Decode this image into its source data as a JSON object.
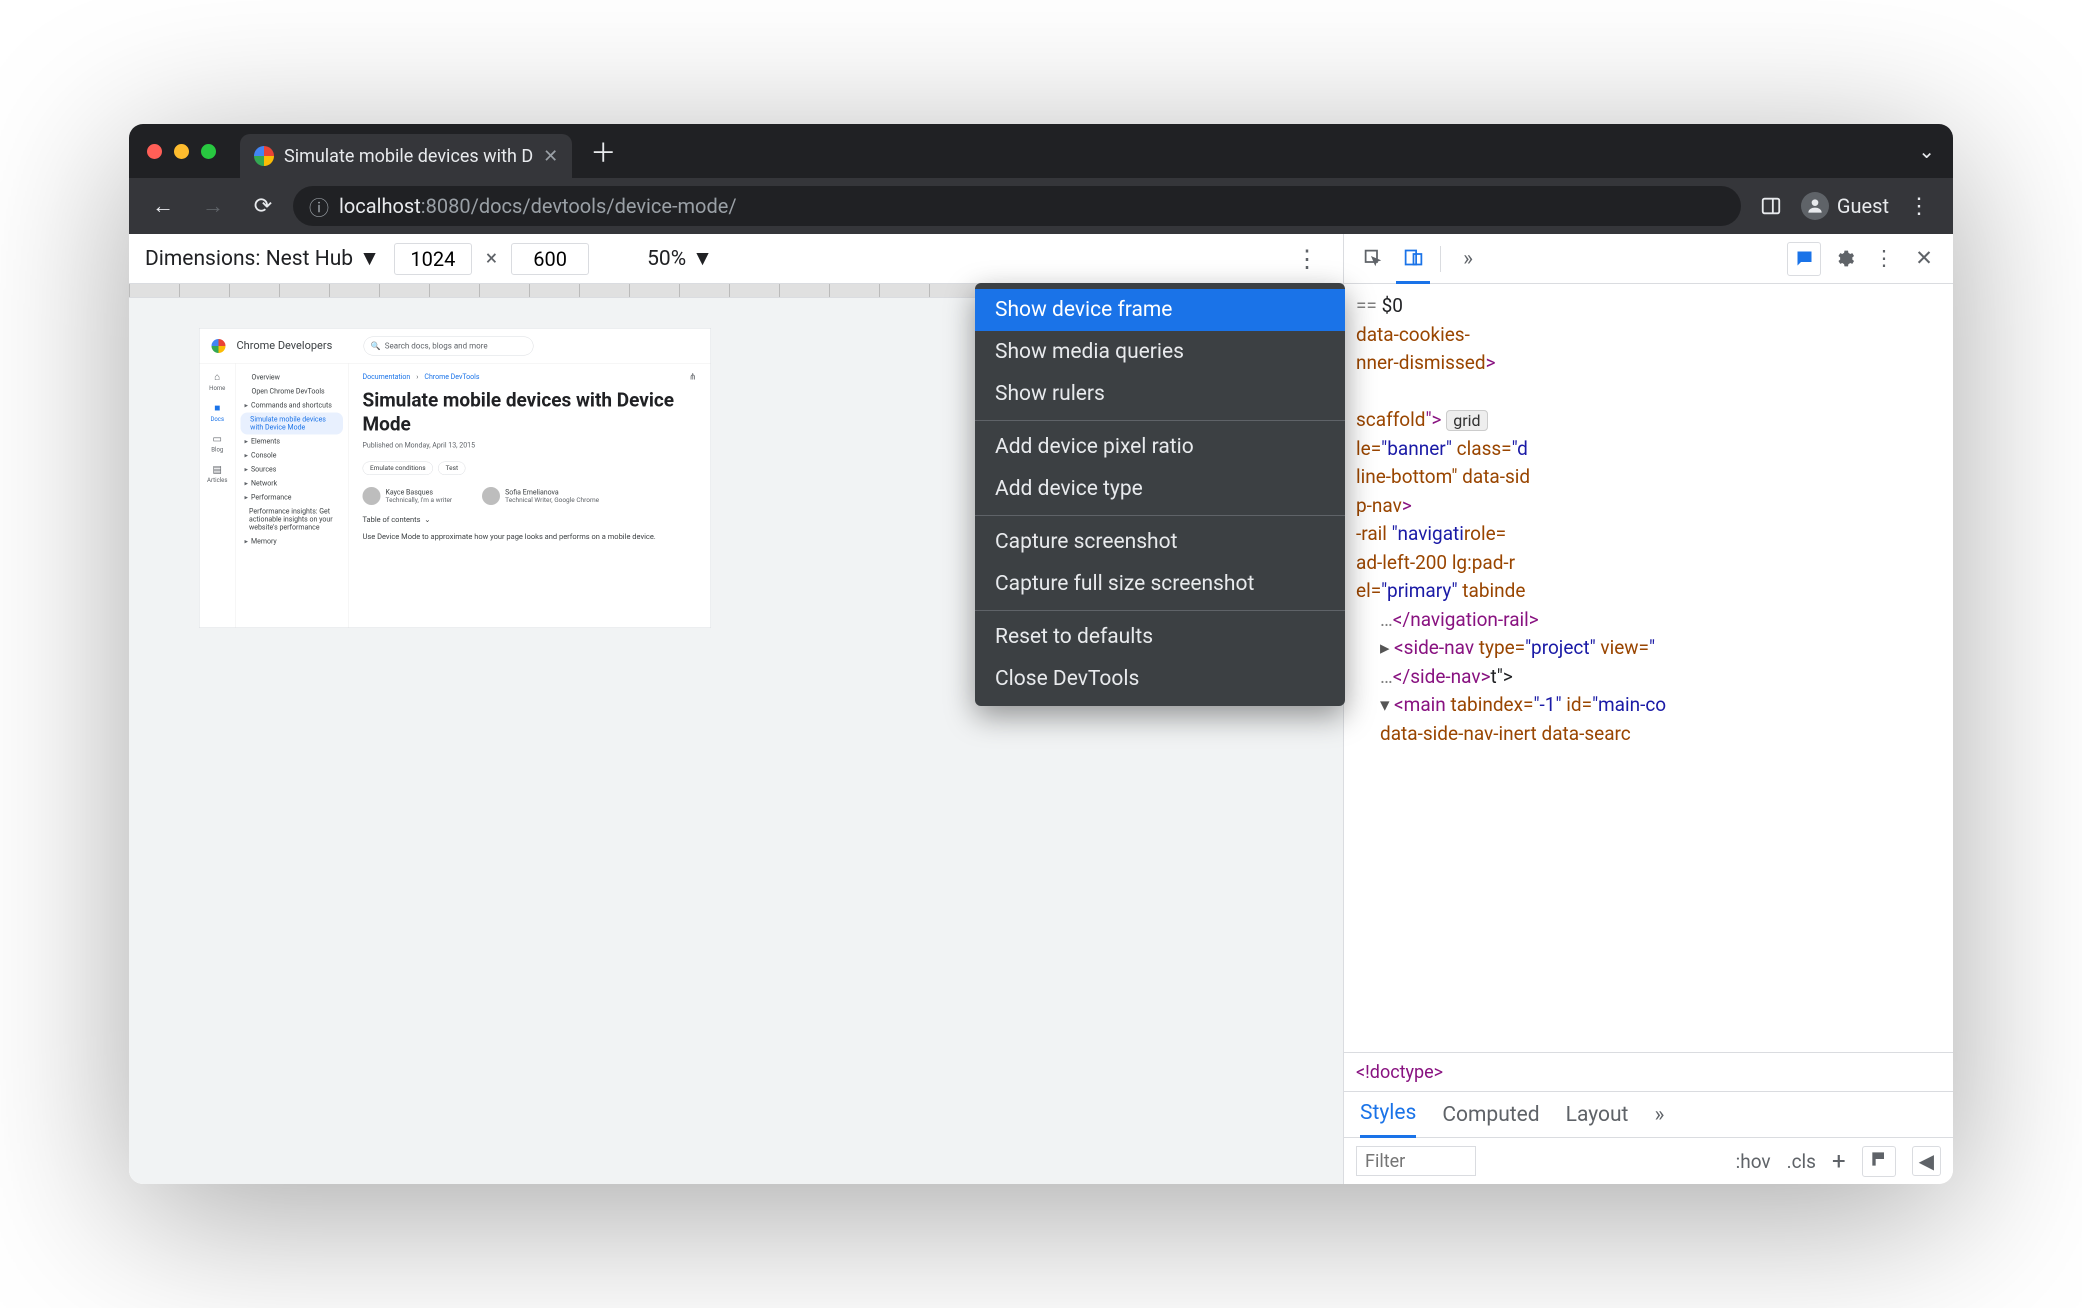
{
  "titlebar": {
    "tab_title": "Simulate mobile devices with D"
  },
  "toolbar": {
    "url_prefix": "localhost",
    "url_rest": ":8080/docs/devtools/device-mode/",
    "guest_label": "Guest"
  },
  "dim_bar": {
    "label": "Dimensions: Nest Hub",
    "width": "1024",
    "height": "600",
    "zoom": "50%"
  },
  "menu": {
    "items": [
      "Show device frame",
      "Show media queries",
      "Show rulers",
      "Add device pixel ratio",
      "Add device type",
      "Capture screenshot",
      "Capture full size screenshot",
      "Reset to defaults",
      "Close DevTools"
    ]
  },
  "mini": {
    "brand": "Chrome Developers",
    "search_placeholder": "Search docs, blogs and more",
    "nav": [
      "Home",
      "Docs",
      "Blog",
      "Articles"
    ],
    "side": [
      "Overview",
      "Open Chrome DevTools",
      "Commands and shortcuts",
      "Simulate mobile devices with Device Mode",
      "Elements",
      "Console",
      "Sources",
      "Network",
      "Performance",
      "Performance insights: Get actionable insights on your website's performance",
      "Memory"
    ],
    "breadcrumb": [
      "Documentation",
      "Chrome DevTools"
    ],
    "h1": "Simulate mobile devices with Device Mode",
    "published": "Published on Monday, April 13, 2015",
    "chips": [
      "Emulate conditions",
      "Test"
    ],
    "authors": [
      {
        "name": "Kayce Basques",
        "role": "Technically, I'm a writer"
      },
      {
        "name": "Sofia Emelianova",
        "role": "Technical Writer, Google Chrome"
      }
    ],
    "toc": "Table of contents",
    "para": "Use Device Mode to approximate how your page looks and performs on a mobile device."
  },
  "devtools": {
    "dom_lines": [
      {
        "indent": 0,
        "gray": "== ",
        "plain": "$0"
      },
      {
        "indent": 0,
        "attr": "data-cookies-"
      },
      {
        "indent": 0,
        "attr": "nner-dismissed",
        "tagclose": ">"
      },
      {
        "indent": 0,
        "blank": true
      },
      {
        "indent": 0,
        "attr": "scaffold",
        "tagclose": "\">",
        "badge": "grid"
      },
      {
        "indent": 0,
        "attr": "le=",
        "val": "\"banner\"",
        "attr2": " class=",
        "val2": "\"d"
      },
      {
        "indent": 0,
        "attr": "line-bottom\"",
        "attr2": " data-sid"
      },
      {
        "indent": 0,
        "attr": "p-nav",
        "tagclose": ">"
      },
      {
        "indent": 0,
        "attr": "-rail ",
        "attr2": "role=",
        "val": "\"navigati"
      },
      {
        "indent": 0,
        "attr": "ad-left-200 lg:pad-r"
      },
      {
        "indent": 0,
        "attr": "el=",
        "val": "\"primary\"",
        "attr2": " tabinde"
      },
      {
        "indent": 1,
        "gray": "…",
        "tag": "</navigation-rail>"
      },
      {
        "indent": 1,
        "caret": "▸",
        "tag": "<side-nav ",
        "attr": "type=",
        "val": "\"project\"",
        "attr2": " view=",
        "val2": "\""
      },
      {
        "indent": 1,
        "plain": "t\">",
        "gray": "…",
        "tag": "</side-nav>"
      },
      {
        "indent": 1,
        "caret": "▾",
        "tag": "<main ",
        "attr": "tabindex=",
        "val": "\"-1\"",
        "attr2": " id=",
        "val2": "\"main-co"
      },
      {
        "indent": 1,
        "attr": "data-side-nav-inert data-searc"
      }
    ],
    "crumb": "<!doctype>",
    "tabs": [
      "Styles",
      "Computed",
      "Layout"
    ],
    "filter_placeholder": "Filter",
    "hov": ":hov",
    "cls": ".cls"
  }
}
